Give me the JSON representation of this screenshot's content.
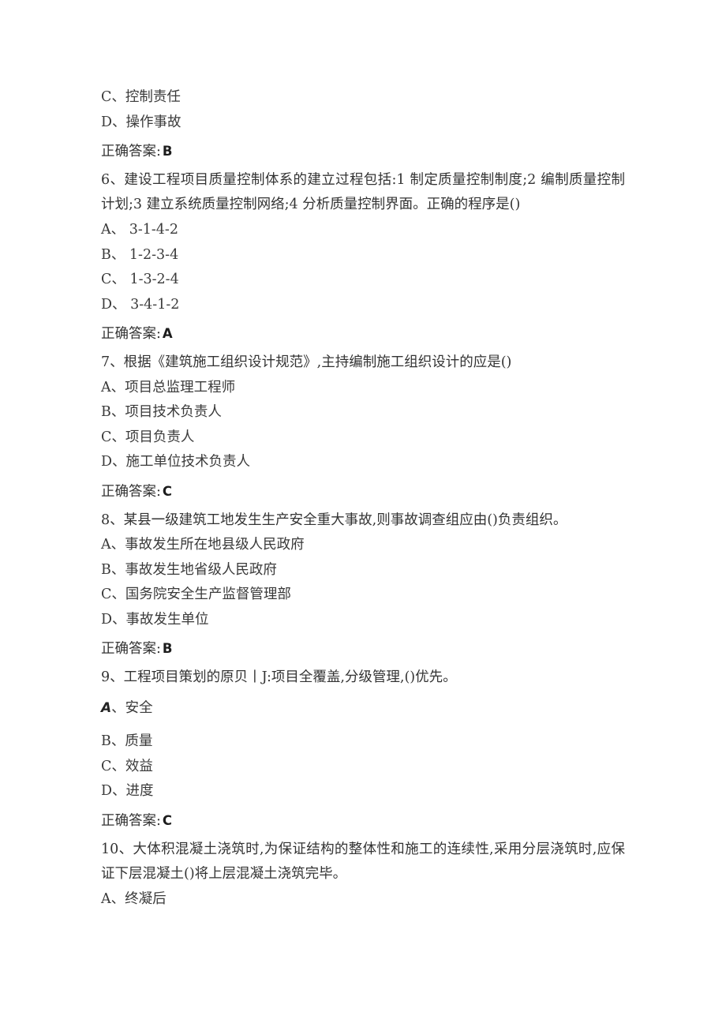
{
  "document": {
    "type": "exam-question-sheet",
    "answer_prefix": "正确答案:"
  },
  "blocks": [
    {
      "kind": "option",
      "id": "q5-option-c",
      "text": "C、控制责任"
    },
    {
      "kind": "option",
      "id": "q5-option-d",
      "text": "D、操作事故"
    },
    {
      "kind": "answer",
      "id": "q5-answer",
      "label": "正确答案:",
      "value": "B"
    },
    {
      "kind": "stem",
      "id": "q6-stem",
      "text": "6、建设工程项目质量控制体系的建立过程包括:1 制定质量控制制度;2 编制质量控制计划;3 建立系统质量控制网络;4 分析质量控制界面。正确的程序是()"
    },
    {
      "kind": "option",
      "id": "q6-option-a",
      "text": "A、 3-1-4-2"
    },
    {
      "kind": "option",
      "id": "q6-option-b",
      "text": "B、 1-2-3-4"
    },
    {
      "kind": "option",
      "id": "q6-option-c",
      "text": "C、 1-3-2-4"
    },
    {
      "kind": "option",
      "id": "q6-option-d",
      "text": "D、 3-4-1-2"
    },
    {
      "kind": "answer",
      "id": "q6-answer",
      "label": "正确答案:",
      "value": "A"
    },
    {
      "kind": "stem",
      "id": "q7-stem",
      "text": "7、根据《建筑施工组织设计规范》,主持编制施工组织设计的应是()"
    },
    {
      "kind": "option",
      "id": "q7-option-a",
      "text": "A、项目总监理工程师"
    },
    {
      "kind": "option",
      "id": "q7-option-b",
      "text": "B、项目技术负责人"
    },
    {
      "kind": "option",
      "id": "q7-option-c",
      "text": "C、项目负责人"
    },
    {
      "kind": "option",
      "id": "q7-option-d",
      "text": "D、施工单位技术负责人"
    },
    {
      "kind": "answer",
      "id": "q7-answer",
      "label": "正确答案:",
      "value": "C"
    },
    {
      "kind": "stem",
      "id": "q8-stem",
      "text": "8、某县一级建筑工地发生生产安全重大事故,则事故调查组应由()负责组织。"
    },
    {
      "kind": "option",
      "id": "q8-option-a",
      "text": "A、事故发生所在地县级人民政府"
    },
    {
      "kind": "option",
      "id": "q8-option-b",
      "text": "B、事故发生地省级人民政府"
    },
    {
      "kind": "option",
      "id": "q8-option-c",
      "text": "C、国务院安全生产监督管理部"
    },
    {
      "kind": "option",
      "id": "q8-option-d",
      "text": "D、事故发生单位"
    },
    {
      "kind": "answer",
      "id": "q8-answer",
      "label": "正确答案:",
      "value": "B"
    },
    {
      "kind": "stem",
      "id": "q9-stem",
      "text": "9、工程项目策划的原贝丨J:项目全覆盖,分级管理,()优先。"
    },
    {
      "kind": "option-odd",
      "id": "q9-option-a",
      "letter": "A",
      "rest": "、安全"
    },
    {
      "kind": "option",
      "id": "q9-option-b",
      "text": "B、质量"
    },
    {
      "kind": "option",
      "id": "q9-option-c",
      "text": "C、效益"
    },
    {
      "kind": "option",
      "id": "q9-option-d",
      "text": "D、进度"
    },
    {
      "kind": "answer",
      "id": "q9-answer",
      "label": "正确答案:",
      "value": "C"
    },
    {
      "kind": "stem",
      "id": "q10-stem",
      "text": "10、大体积混凝土浇筑时,为保证结构的整体性和施工的连续性,采用分层浇筑时,应保证下层混凝土()将上层混凝土浇筑完毕。"
    },
    {
      "kind": "option",
      "id": "q10-option-a",
      "text": "A、终凝后"
    }
  ]
}
